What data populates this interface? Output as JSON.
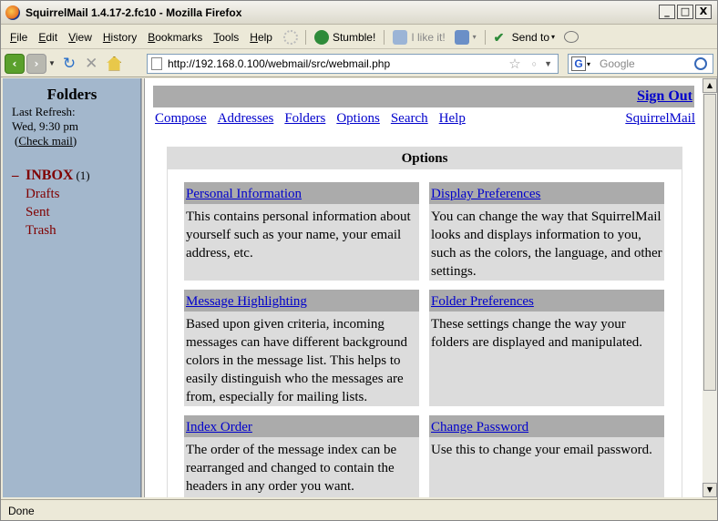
{
  "window": {
    "title": "SquirrelMail 1.4.17-2.fc10 - Mozilla Firefox",
    "controls": [
      "_",
      "□",
      "X"
    ]
  },
  "menubar": {
    "items": [
      {
        "label": "File",
        "key": "F",
        "rest": "ile"
      },
      {
        "label": "Edit",
        "key": "E",
        "rest": "dit"
      },
      {
        "label": "View",
        "key": "V",
        "rest": "iew"
      },
      {
        "label": "History",
        "key": "H",
        "rest": "istory"
      },
      {
        "label": "Bookmarks",
        "key": "B",
        "rest": "ookmarks"
      },
      {
        "label": "Tools",
        "key": "T",
        "rest": "ools"
      },
      {
        "label": "Help",
        "key": "H",
        "rest": "elp"
      }
    ],
    "stumble": "Stumble!",
    "ilikeit": "I like it!",
    "sendto": "Send to"
  },
  "navbar": {
    "url": "http://192.168.0.100/webmail/src/webmail.php",
    "search_placeholder": "Google"
  },
  "left": {
    "title": "Folders",
    "last_refresh_label": "Last Refresh:",
    "last_refresh_time": "Wed, 9:30 pm",
    "check_mail": "Check mail",
    "collapse_symbol": "–",
    "inbox": "INBOX",
    "inbox_count": "(1)",
    "folders": [
      "Drafts",
      "Sent",
      "Trash"
    ]
  },
  "right": {
    "sign_out": "Sign Out",
    "nav": [
      "Compose",
      "Addresses",
      "Folders",
      "Options",
      "Search",
      "Help"
    ],
    "squirrelmail_link": "SquirrelMail",
    "options_title": "Options",
    "options": [
      {
        "title": "Personal Information",
        "desc": "This contains personal information about yourself such as your name, your email address, etc."
      },
      {
        "title": "Display Preferences",
        "desc": "You can change the way that SquirrelMail looks and displays information to you, such as the colors, the language, and other settings."
      },
      {
        "title": "Message Highlighting",
        "desc": "Based upon given criteria, incoming messages can have different background colors in the message list. This helps to easily distinguish who the messages are from, especially for mailing lists."
      },
      {
        "title": "Folder Preferences",
        "desc": "These settings change the way your folders are displayed and manipulated."
      },
      {
        "title": "Index Order",
        "desc": "The order of the message index can be rearranged and changed to contain the headers in any order you want."
      },
      {
        "title": "Change Password",
        "desc": "Use this to change your email password."
      }
    ]
  },
  "status": {
    "text": "Done"
  }
}
